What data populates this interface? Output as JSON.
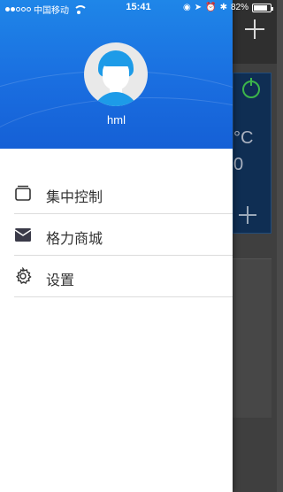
{
  "status_bar": {
    "carrier": "中国移动",
    "time": "15:41",
    "battery": "82%",
    "battery_level": 0.82,
    "icons": [
      "signal-dots-icon",
      "wifi-icon",
      "orientation-lock-icon",
      "location-icon",
      "alarm-icon",
      "bluetooth-icon",
      "battery-icon"
    ]
  },
  "drawer": {
    "username": "hml",
    "header_color": "#1a6ee0",
    "menu": [
      {
        "label": "集中控制",
        "icon": "device-control-icon"
      },
      {
        "label": "格力商城",
        "icon": "shop-icon"
      },
      {
        "label": "设置",
        "icon": "gear-icon"
      }
    ]
  },
  "background_app": {
    "temp_unit_partial": "°C",
    "temp_partial": "0"
  }
}
